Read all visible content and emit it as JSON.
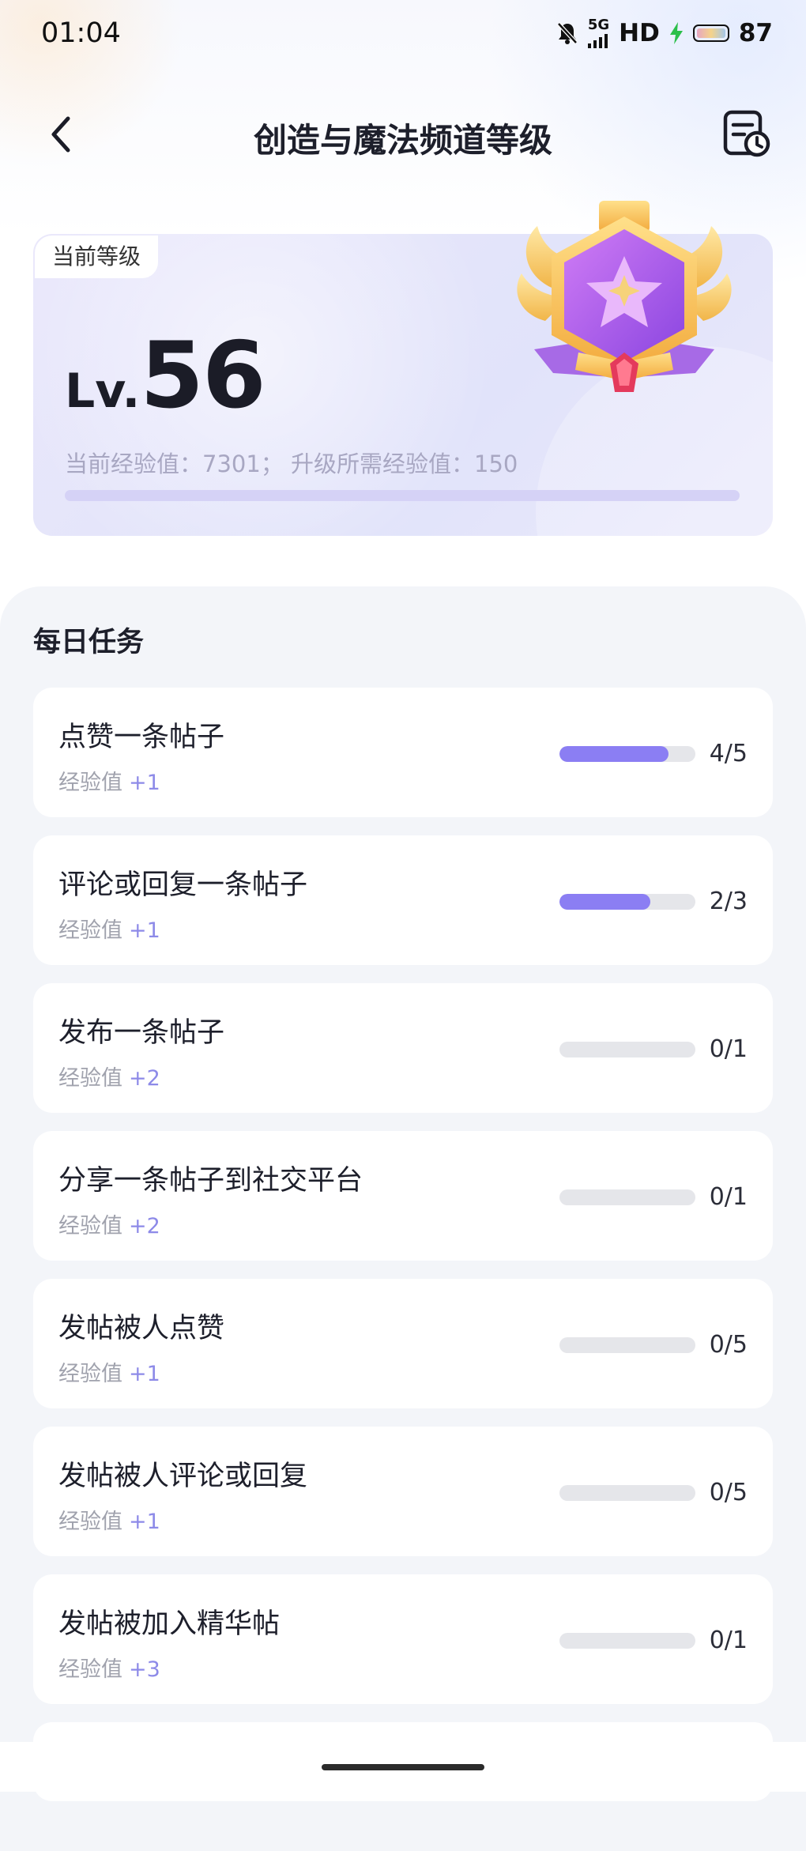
{
  "status_bar": {
    "time": "01:04",
    "network": "5G",
    "hd": "HD",
    "battery": "87"
  },
  "header": {
    "title": "创造与魔法频道等级",
    "back_icon": "chevron-left-icon",
    "history_icon": "record-clock-icon"
  },
  "level_card": {
    "tag": "当前等级",
    "lv_prefix": "Lv.",
    "level": "56",
    "exp_text": "当前经验值：7301； 升级所需经验值：150",
    "badge_icon": "star-shield-badge-icon",
    "colors": {
      "accent": "#8b7ef3",
      "card_bg": "#e6e5fa"
    }
  },
  "daily_tasks": {
    "title": "每日任务",
    "reward_label": "经验值",
    "items": [
      {
        "name": "点赞一条帖子",
        "reward": "+1",
        "progress": "4/5",
        "fraction": 0.8
      },
      {
        "name": "评论或回复一条帖子",
        "reward": "+1",
        "progress": "2/3",
        "fraction": 0.667
      },
      {
        "name": "发布一条帖子",
        "reward": "+2",
        "progress": "0/1",
        "fraction": 0
      },
      {
        "name": "分享一条帖子到社交平台",
        "reward": "+2",
        "progress": "0/1",
        "fraction": 0
      },
      {
        "name": "发帖被人点赞",
        "reward": "+1",
        "progress": "0/5",
        "fraction": 0
      },
      {
        "name": "发帖被人评论或回复",
        "reward": "+1",
        "progress": "0/5",
        "fraction": 0
      },
      {
        "name": "发帖被加入精华帖",
        "reward": "+3",
        "progress": "0/1",
        "fraction": 0
      }
    ]
  }
}
